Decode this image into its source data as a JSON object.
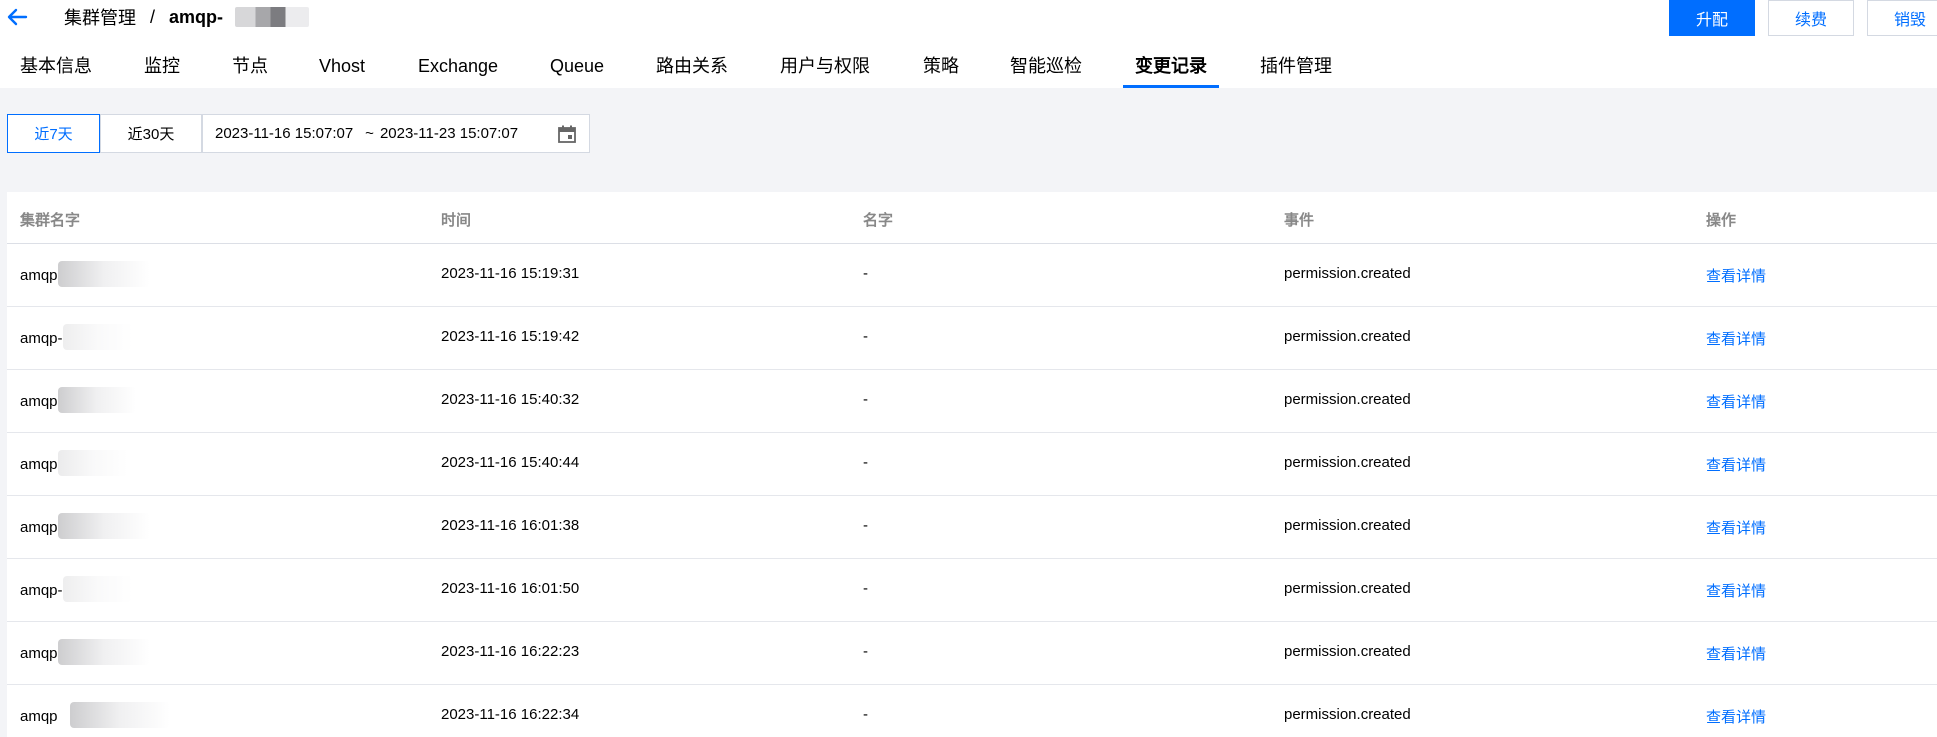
{
  "header": {
    "breadcrumb_parent": "集群管理",
    "breadcrumb_sep": "/",
    "breadcrumb_current": "amqp-",
    "buttons": {
      "upgrade": "升配",
      "renew": "续费",
      "destroy": "销毁"
    }
  },
  "tabs": [
    {
      "label": "基本信息"
    },
    {
      "label": "监控"
    },
    {
      "label": "节点"
    },
    {
      "label": "Vhost"
    },
    {
      "label": "Exchange"
    },
    {
      "label": "Queue"
    },
    {
      "label": "路由关系"
    },
    {
      "label": "用户与权限"
    },
    {
      "label": "策略"
    },
    {
      "label": "智能巡检"
    },
    {
      "label": "变更记录"
    },
    {
      "label": "插件管理"
    }
  ],
  "active_tab": "变更记录",
  "filter": {
    "btn_7d": "近7天",
    "btn_30d": "近30天",
    "date_start": "2023-11-16 15:07:07",
    "date_sep": "~",
    "date_end": "2023-11-23 15:07:07"
  },
  "table": {
    "columns": [
      "集群名字",
      "时间",
      "名字",
      "事件",
      "操作"
    ],
    "rows": [
      {
        "cluster": "amqp",
        "time": "2023-11-16 15:19:31",
        "name": "-",
        "event": "permission.created",
        "action": "查看详情"
      },
      {
        "cluster": "amqp-",
        "time": "2023-11-16 15:19:42",
        "name": "-",
        "event": "permission.created",
        "action": "查看详情"
      },
      {
        "cluster": "amqp",
        "time": "2023-11-16 15:40:32",
        "name": "-",
        "event": "permission.created",
        "action": "查看详情"
      },
      {
        "cluster": "amqp",
        "time": "2023-11-16 15:40:44",
        "name": "-",
        "event": "permission.created",
        "action": "查看详情"
      },
      {
        "cluster": "amqp",
        "time": "2023-11-16 16:01:38",
        "name": "-",
        "event": "permission.created",
        "action": "查看详情"
      },
      {
        "cluster": "amqp-",
        "time": "2023-11-16 16:01:50",
        "name": "-",
        "event": "permission.created",
        "action": "查看详情"
      },
      {
        "cluster": "amqp",
        "time": "2023-11-16 16:22:23",
        "name": "-",
        "event": "permission.created",
        "action": "查看详情"
      },
      {
        "cluster": "amqp",
        "time": "2023-11-16 16:22:34",
        "name": "-",
        "event": "permission.created",
        "action": "查看详情"
      }
    ]
  },
  "colors": {
    "accent": "#006eff",
    "bg": "#f3f4f7"
  }
}
